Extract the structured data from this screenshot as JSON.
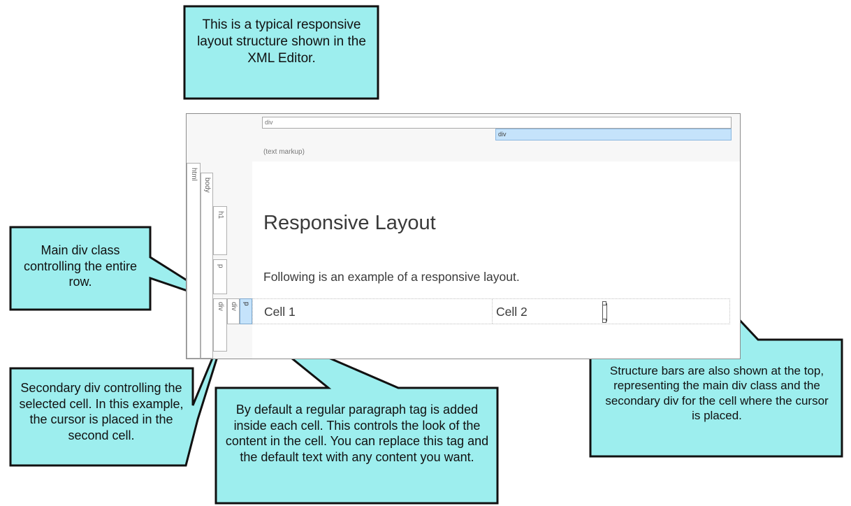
{
  "callouts": {
    "top": "This is a typical responsive layout structure shown in the XML Editor.",
    "main_div": "Main div class controlling the entire row.",
    "secondary_div": "Secondary div controlling the selected cell. In this example, the cursor is placed in the second cell.",
    "paragraph": "By default a regular paragraph tag is added inside each cell. This controls the look of the content in the cell. You can replace this tag and the default text with any content you want.",
    "structure_bars": "Structure bars are also shown at the top, representing the main div class and the secondary div for the cell where the cursor is placed."
  },
  "editor": {
    "top_bars": {
      "main_div": "div",
      "cell_div": "div"
    },
    "text_markup": "(text markup)",
    "side_bars": {
      "html": "html",
      "body": "body",
      "h1": "h1",
      "p": "p",
      "div_main": "div",
      "div_cell": "div",
      "p_cell": "p"
    },
    "heading": "Responsive Layout",
    "paragraph": "Following is an example of a responsive layout.",
    "cells": [
      "Cell 1",
      "Cell 2"
    ]
  },
  "colors": {
    "callout_fill": "#9deeee",
    "callout_border": "#111111",
    "selected_bar": "#c5e3fb"
  }
}
